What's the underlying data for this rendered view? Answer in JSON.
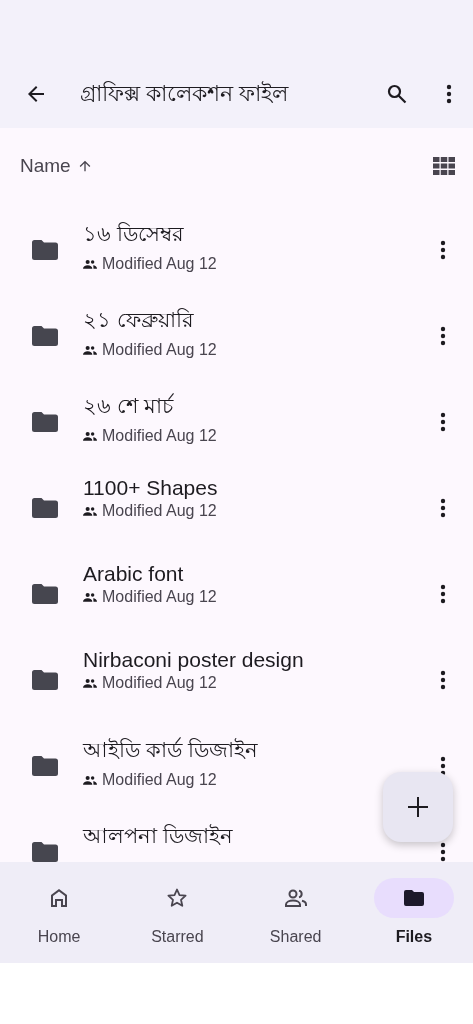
{
  "app_bar": {
    "title": "গ্রাফিক্স কালেকশন ফাইল"
  },
  "sort": {
    "label": "Name"
  },
  "folders": [
    {
      "name": "১৬ ডিসেম্বর",
      "subtitle": "Modified Aug 12"
    },
    {
      "name": "২১ ফেব্রুয়ারি",
      "subtitle": "Modified Aug 12"
    },
    {
      "name": "২৬ শে মার্চ",
      "subtitle": "Modified Aug 12"
    },
    {
      "name": "1100+ Shapes",
      "subtitle": "Modified Aug 12"
    },
    {
      "name": "Arabic font",
      "subtitle": "Modified Aug 12"
    },
    {
      "name": "Nirbaconi poster design",
      "subtitle": "Modified Aug 12"
    },
    {
      "name": "আইডি কার্ড ডিজাইন",
      "subtitle": "Modified Aug 12"
    },
    {
      "name": "আলপনা ডিজাইন"
    }
  ],
  "nav": [
    {
      "kind": "home",
      "label": "Home",
      "selected": false
    },
    {
      "kind": "starred",
      "label": "Starred",
      "selected": false
    },
    {
      "kind": "shared",
      "label": "Shared",
      "selected": false
    },
    {
      "kind": "files",
      "label": "Files",
      "selected": true
    }
  ]
}
